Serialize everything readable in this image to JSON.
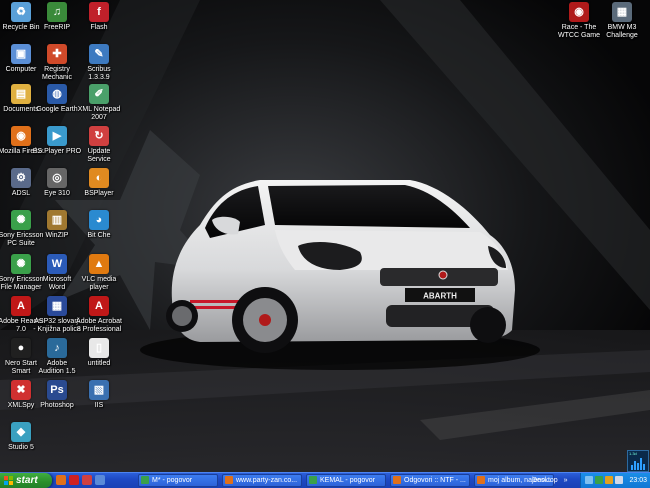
{
  "desktop": {
    "icons": [
      {
        "id": "recycle-bin",
        "label": "Recycle Bin",
        "glyph": "♻",
        "color": "#5aa0d8"
      },
      {
        "id": "freerip",
        "label": "FreeRIP",
        "glyph": "♫",
        "color": "#3a8a3a"
      },
      {
        "id": "flash",
        "label": "Flash",
        "glyph": "f",
        "color": "#c0202a"
      },
      {
        "id": "computer",
        "label": "Computer",
        "glyph": "▣",
        "color": "#5b8fd6"
      },
      {
        "id": "registry-mechanic",
        "label": "Registry\nMechanic",
        "glyph": "✚",
        "color": "#d04a2a"
      },
      {
        "id": "scribus",
        "label": "Scribus\n1.3.3.9",
        "glyph": "✎",
        "color": "#3d7ac0"
      },
      {
        "id": "documents",
        "label": "Documents",
        "glyph": "▤",
        "color": "#e0b040"
      },
      {
        "id": "google-earth",
        "label": "Google Earth",
        "glyph": "◍",
        "color": "#2a5aa8"
      },
      {
        "id": "xml-notepad",
        "label": "XML Notepad\n2007",
        "glyph": "✐",
        "color": "#4aa06a"
      },
      {
        "id": "mozilla-firefox",
        "label": "Mozilla Firefox",
        "glyph": "◉",
        "color": "#e0701a"
      },
      {
        "id": "bsplayer",
        "label": "BS.Player PRO",
        "glyph": "▶",
        "color": "#3a9acc"
      },
      {
        "id": "update-service",
        "label": "Update\nService",
        "glyph": "↻",
        "color": "#d04040"
      },
      {
        "id": "adsl",
        "label": "ADSL",
        "glyph": "⚙",
        "color": "#5a6a8a"
      },
      {
        "id": "eye-310",
        "label": "Eye 310",
        "glyph": "◎",
        "color": "#666"
      },
      {
        "id": "bsplayer2",
        "label": "BSPlayer",
        "glyph": "◐",
        "color": "#e08a20"
      },
      {
        "id": "sony-ericsson-pc-suite",
        "label": "Sony Ericsson\nPC Suite",
        "glyph": "✺",
        "color": "#3aa04a"
      },
      {
        "id": "winzip",
        "label": "WinZIP",
        "glyph": "▥",
        "color": "#a07830"
      },
      {
        "id": "bit-che",
        "label": "Bit Che",
        "glyph": "◕",
        "color": "#2a8ad0"
      },
      {
        "id": "sony-ericsson-file-manager",
        "label": "Sony Ericsson\nFile Manager",
        "glyph": "✺",
        "color": "#3aa04a"
      },
      {
        "id": "microsoft-word",
        "label": "Microsoft\nWord",
        "glyph": "W",
        "color": "#2b5bb8"
      },
      {
        "id": "vlc",
        "label": "VLC media\nplayer",
        "glyph": "▲",
        "color": "#e07a10"
      },
      {
        "id": "adobe-reader",
        "label": "Adobe Reader\n7.0",
        "glyph": "A",
        "color": "#c01818"
      },
      {
        "id": "asp32",
        "label": "ASP32 slovarji\n- Knjižna polica",
        "glyph": "▦",
        "color": "#2a4a9a"
      },
      {
        "id": "adobe-acrobat",
        "label": "Adobe Acrobat\n8 Professional",
        "glyph": "A",
        "color": "#c01818"
      },
      {
        "id": "nero-start-smart",
        "label": "Nero Start\nSmart",
        "glyph": "●",
        "color": "#202020"
      },
      {
        "id": "adobe-audition",
        "label": "Adobe\nAudition 1.5",
        "glyph": "♪",
        "color": "#2a6a9a"
      },
      {
        "id": "untitled",
        "label": "untitled",
        "glyph": "▯",
        "color": "#e8e8e8"
      },
      {
        "id": "xmlspy",
        "label": "XMLSpy",
        "glyph": "✖",
        "color": "#d03030"
      },
      {
        "id": "photoshop",
        "label": "Photoshop",
        "glyph": "Ps",
        "color": "#2a4a90"
      },
      {
        "id": "iis",
        "label": "IIS",
        "glyph": "▧",
        "color": "#3a70b0"
      },
      {
        "id": "studio-5",
        "label": "Studio 5",
        "glyph": "◆",
        "color": "#3aa0c0"
      }
    ],
    "right_icons": [
      {
        "id": "race-wtcc",
        "label": "Race - The\nWTCC Game",
        "glyph": "◉",
        "color": "#b01a1a"
      },
      {
        "id": "bmw-m3",
        "label": "BMW M3\nChallenge",
        "glyph": "▦",
        "color": "#5a6a7a"
      }
    ]
  },
  "wallpaper": {
    "badge_text": "ABARTH"
  },
  "taskbar": {
    "start_label": "start",
    "quick_launch": [
      {
        "id": "firefox",
        "color": "#e0701a"
      },
      {
        "id": "nero",
        "color": "#d02020"
      },
      {
        "id": "misc",
        "color": "#d04040"
      },
      {
        "id": "show-desktop",
        "color": "#5a8ad8"
      }
    ],
    "tasks": [
      {
        "id": "task-1",
        "label": "M* - pogovor",
        "color": "#3aa04a"
      },
      {
        "id": "task-2",
        "label": "www.party-zan.co...",
        "color": "#e0701a"
      },
      {
        "id": "task-3",
        "label": "KEMAL - pogovor",
        "color": "#3aa04a"
      },
      {
        "id": "task-4",
        "label": "Odgovori :: NTF - ...",
        "color": "#e0701a"
      },
      {
        "id": "task-5",
        "label": "moj album, najeno...",
        "color": "#e0701a"
      }
    ],
    "desktop_label": "Desktop",
    "desktop_chevron": "»",
    "clock": "23:03"
  },
  "meter": {
    "text": "1.3d"
  }
}
